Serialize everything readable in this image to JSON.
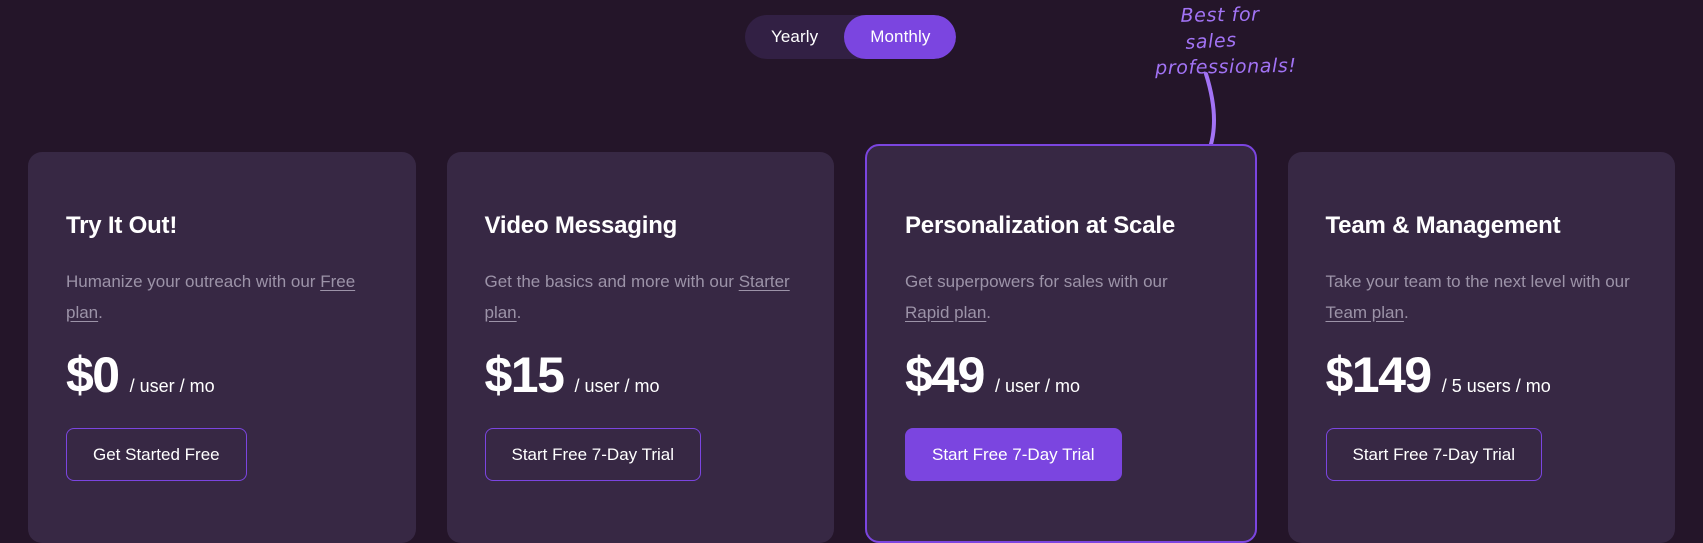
{
  "billing_toggle": {
    "options": [
      {
        "label": "Yearly",
        "active": false
      },
      {
        "label": "Monthly",
        "active": true
      }
    ]
  },
  "annotation": {
    "line1": "Best for",
    "line2": "sales",
    "line3": "professionals!",
    "color": "#A273F5"
  },
  "colors": {
    "background": "#241529",
    "card": "#372844",
    "accent": "#7B45E0",
    "muted_text": "#9C93A8",
    "text": "#FFFFFF"
  },
  "plans": [
    {
      "title": "Try It Out!",
      "desc_before": "Humanize your outreach with our ",
      "plan_link": "Free plan",
      "desc_after": ".",
      "price": "$0",
      "price_suffix": "/ user / mo",
      "cta_label": "Get Started Free",
      "cta_style": "outline",
      "featured": false
    },
    {
      "title": "Video Messaging",
      "desc_before": "Get the basics and more with our ",
      "plan_link": "Starter plan",
      "desc_after": ".",
      "price": "$15",
      "price_suffix": "/ user / mo",
      "cta_label": "Start Free 7-Day Trial",
      "cta_style": "outline",
      "featured": false
    },
    {
      "title": "Personalization at Scale",
      "desc_before": "Get superpowers for sales with our ",
      "plan_link": "Rapid plan",
      "desc_after": ".",
      "price": "$49",
      "price_suffix": "/ user / mo",
      "cta_label": "Start Free 7-Day Trial",
      "cta_style": "filled",
      "featured": true
    },
    {
      "title": "Team & Management",
      "desc_before": "Take your team to the next level with our ",
      "plan_link": "Team plan",
      "desc_after": ".",
      "price": "$149",
      "price_suffix": "/ 5 users / mo",
      "cta_label": "Start Free 7-Day Trial",
      "cta_style": "outline",
      "featured": false
    }
  ]
}
